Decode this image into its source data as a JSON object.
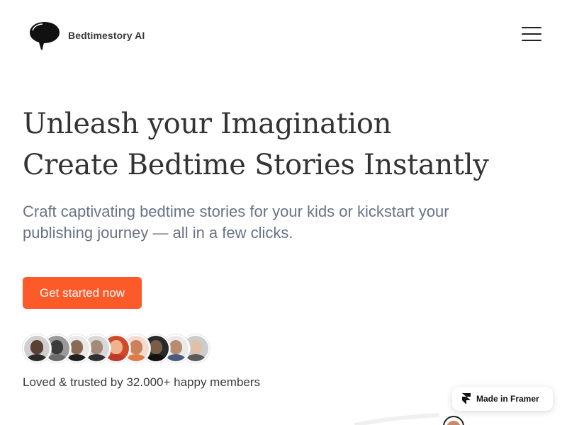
{
  "header": {
    "brand_name": "Bedtimestory AI",
    "logo_icon": "speech-bubble-icon",
    "menu_icon": "hamburger-menu-icon"
  },
  "hero": {
    "headline_line1": "Unleash your Imagination",
    "headline_line2": "Create Bedtime Stories Instantly",
    "subtitle": "Craft captivating bedtime stories for your kids or kickstart your publishing journey — all in a few clicks.",
    "cta_label": "Get started now",
    "trust_text": "Loved & trusted by 32.000+ happy members"
  },
  "avatars": [
    {
      "name": "avatar-1",
      "bg": "#cfcfcf",
      "face": "#5a3f33",
      "body": "#2b2b2b"
    },
    {
      "name": "avatar-2",
      "bg": "#9a9a9a",
      "face": "#3b3b3b",
      "body": "#6b6b6b"
    },
    {
      "name": "avatar-3",
      "bg": "#e9e9e9",
      "face": "#8b6a55",
      "body": "#1f1f1f"
    },
    {
      "name": "avatar-4",
      "bg": "#d8d8d8",
      "face": "#a58a78",
      "body": "#303030"
    },
    {
      "name": "avatar-5",
      "bg": "#d04a2a",
      "face": "#f0b48c",
      "body": "#c0392b"
    },
    {
      "name": "avatar-6",
      "bg": "#f2dccf",
      "face": "#c9825c",
      "body": "#e07a4a"
    },
    {
      "name": "avatar-7",
      "bg": "#2a2a2a",
      "face": "#7a5c48",
      "body": "#111111"
    },
    {
      "name": "avatar-8",
      "bg": "#eaeaea",
      "face": "#b98b70",
      "body": "#4a5a7a"
    },
    {
      "name": "avatar-9",
      "bg": "#cccccc",
      "face": "#e0c0a8",
      "body": "#5a5a5a"
    }
  ],
  "badge": {
    "label": "Made in Framer",
    "icon": "framer-logo-icon"
  },
  "colors": {
    "accent": "#fd5a2a",
    "headline": "#333333",
    "subtitle": "#687385"
  }
}
